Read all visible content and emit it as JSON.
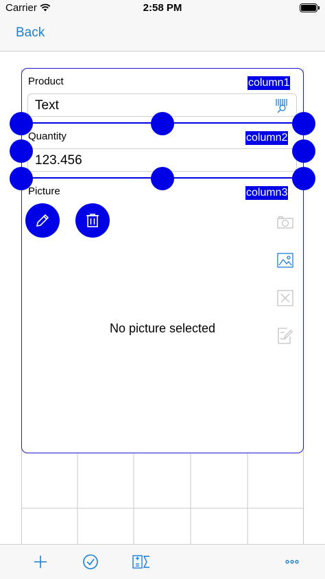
{
  "status_bar": {
    "carrier": "Carrier",
    "time": "2:58 PM",
    "battery_level": 1.0
  },
  "nav": {
    "back_label": "Back"
  },
  "form": {
    "product_label": "Product",
    "product_column": "column1",
    "product_value": "Text",
    "quantity_label": "Quantity",
    "quantity_column": "column2",
    "quantity_value": "123.456",
    "picture_label": "Picture",
    "picture_column": "column3",
    "no_picture_text": "No picture selected"
  },
  "icons": {
    "product_field": "barcode-search-icon",
    "edit": "pencil-icon",
    "delete": "trash-icon",
    "camera": "camera-icon",
    "gallery": "photo-icon",
    "clear": "close-box-icon",
    "signature": "signature-icon",
    "toolbar": [
      "plus-icon",
      "checkmark-circle-icon",
      "calculator-icon",
      "ellipsis-icon"
    ]
  },
  "colors": {
    "accent": "#1c7fd6",
    "selection": "#0000e6",
    "disabled_icon": "#c4c4c4"
  }
}
